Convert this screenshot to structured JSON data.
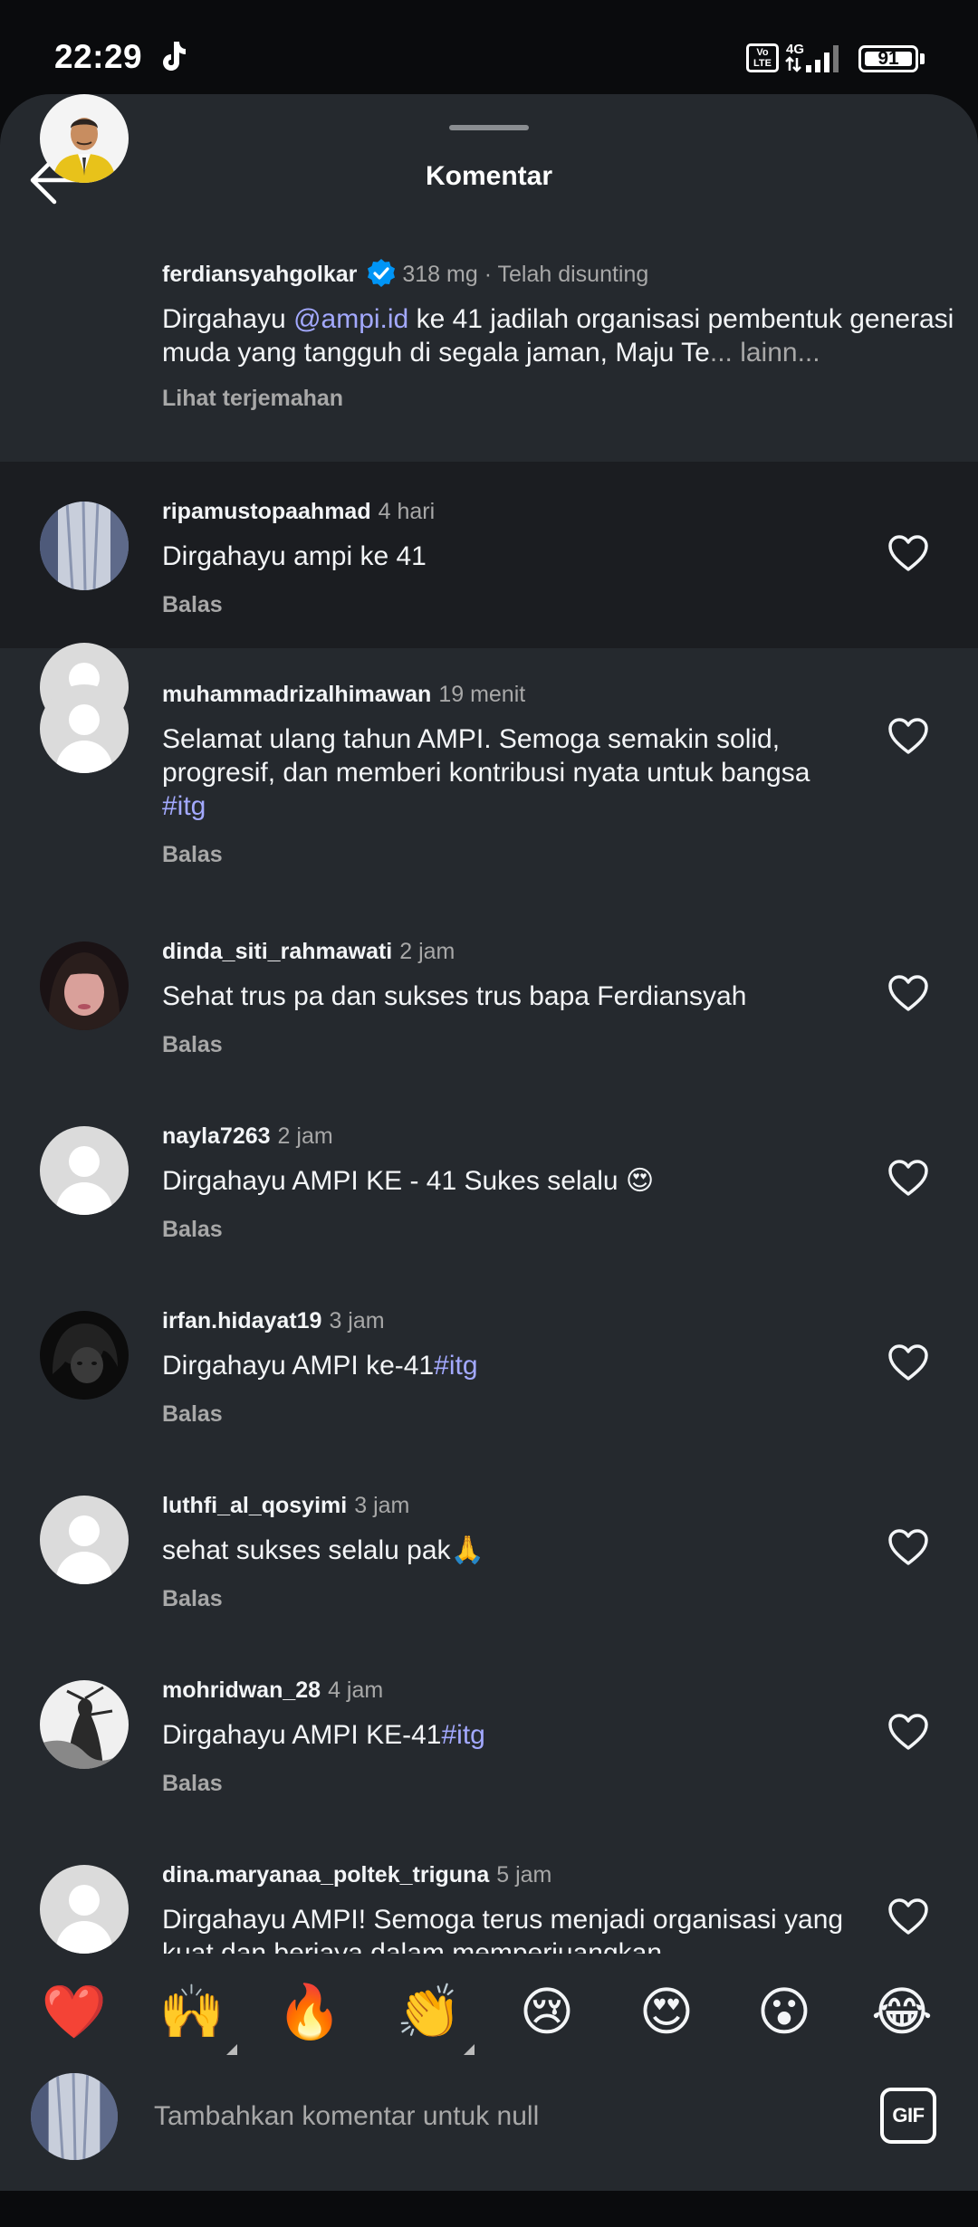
{
  "status_bar": {
    "time": "22:29",
    "volte_label": "Vo\nLTE",
    "network": "4G",
    "battery": "91"
  },
  "header": {
    "title": "Komentar"
  },
  "caption": {
    "username": "ferdiansyahgolkar",
    "meta": "318 mg · Telah disunting",
    "text_prefix": "Dirgahayu ",
    "mention": "@ampi.id",
    "text_rest": " ke 41 jadilah organisasi pembentuk generasi muda yang tangguh di segala jaman, Maju Te",
    "more": "... lainn...",
    "translate": "Lihat terjemahan"
  },
  "comments": [
    {
      "username": "ripamustopaahmad",
      "time": "4 hari",
      "text": "Dirgahayu ampi ke 41",
      "hashtag": "",
      "reply": "Balas"
    },
    {
      "username": "muhammadrizalhimawan",
      "time": "19 menit",
      "text": "Selamat ulang tahun AMPI. Semoga semakin solid, progresif, dan memberi kontribusi nyata untuk bangsa ",
      "hashtag": "#itg",
      "reply": "Balas"
    },
    {
      "username": "dinda_siti_rahmawati",
      "time": "2 jam",
      "text": "Sehat trus pa dan sukses trus bapa Ferdiansyah",
      "hashtag": "",
      "reply": "Balas"
    },
    {
      "username": "nayla7263",
      "time": "2 jam",
      "text": "Dirgahayu AMPI KE - 41 Sukes selalu 😍",
      "hashtag": "",
      "reply": "Balas"
    },
    {
      "username": "irfan.hidayat19",
      "time": "3 jam",
      "text": "Dirgahayu AMPI ke-41",
      "hashtag": "#itg",
      "reply": "Balas"
    },
    {
      "username": "luthfi_al_qosyimi",
      "time": "3 jam",
      "text": "sehat sukses selalu pak🙏",
      "hashtag": "",
      "reply": "Balas"
    },
    {
      "username": "mohridwan_28",
      "time": "4 jam",
      "text": "Dirgahayu AMPI KE-41",
      "hashtag": "#itg",
      "reply": "Balas"
    },
    {
      "username": "dina.maryanaa_poltek_triguna",
      "time": "5 jam",
      "text": "Dirgahayu AMPI! Semoga terus menjadi organisasi yang kuat dan berjaya dalam memperjuangkan",
      "hashtag": "",
      "reply": ""
    }
  ],
  "emoji_bar": [
    "❤️",
    "🙌",
    "🔥",
    "👏",
    "😢",
    "😍",
    "😮",
    "😂"
  ],
  "input": {
    "placeholder": "Tambahkan komentar untuk null",
    "gif_label": "GIF"
  },
  "colors": {
    "background": "#25292e",
    "highlight": "#1b1d21",
    "link": "#a3a9ff",
    "secondary_text": "#a8a8a8",
    "verified": "#0095f6"
  }
}
